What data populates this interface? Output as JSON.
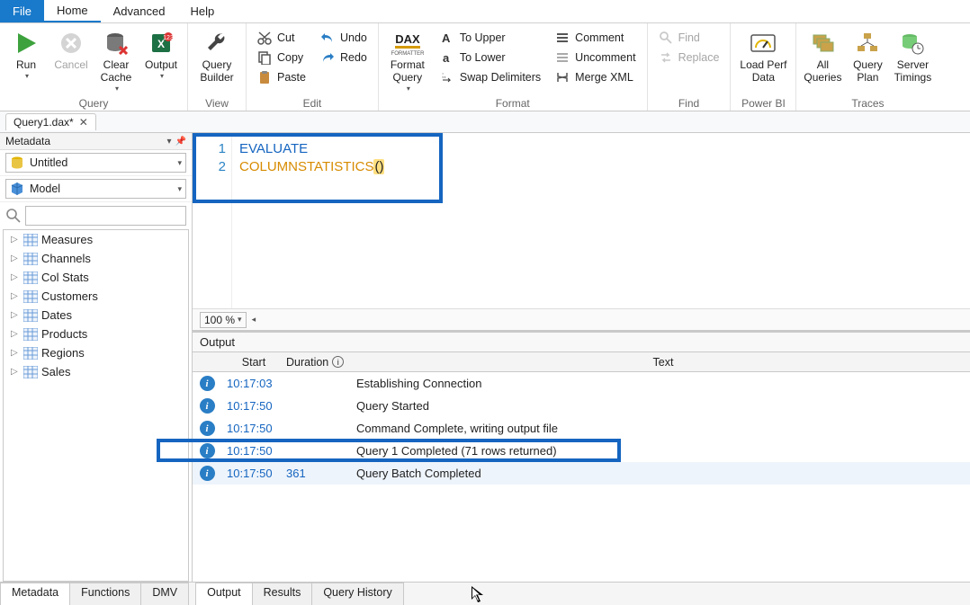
{
  "menu": {
    "file": "File",
    "home": "Home",
    "advanced": "Advanced",
    "help": "Help"
  },
  "ribbon": {
    "run": "Run",
    "cancel": "Cancel",
    "clear_cache": "Clear\nCache",
    "output": "Output",
    "query_builder": "Query\nBuilder",
    "cut": "Cut",
    "copy": "Copy",
    "paste": "Paste",
    "undo": "Undo",
    "redo": "Redo",
    "format_query": "Format\nQuery",
    "to_upper": "To Upper",
    "to_lower": "To Lower",
    "swap_delim": "Swap Delimiters",
    "comment": "Comment",
    "uncomment": "Uncomment",
    "merge_xml": "Merge XML",
    "find": "Find",
    "replace": "Replace",
    "load_perf": "Load Perf\nData",
    "all_queries": "All\nQueries",
    "query_plan": "Query\nPlan",
    "server_timings": "Server\nTimings",
    "groups": {
      "query": "Query",
      "view": "View",
      "edit": "Edit",
      "format": "Format",
      "find_g": "Find",
      "powerbi": "Power BI",
      "traces": "Traces"
    }
  },
  "doc_tab": {
    "name": "Query1.dax*"
  },
  "side": {
    "title": "Metadata",
    "db": "Untitled",
    "model": "Model",
    "items": [
      "Measures",
      "Channels",
      "Col Stats",
      "Customers",
      "Dates",
      "Products",
      "Regions",
      "Sales"
    ]
  },
  "editor": {
    "lines": [
      {
        "n": "1",
        "kw": "EVALUATE"
      },
      {
        "n": "2",
        "fn": "COLUMNSTATISTICS",
        "paren": "()"
      }
    ],
    "zoom": "100 %"
  },
  "output": {
    "title": "Output",
    "cols": {
      "start": "Start",
      "duration": "Duration",
      "text": "Text"
    },
    "rows": [
      {
        "start": "10:17:03",
        "dur": "",
        "text": "Establishing Connection"
      },
      {
        "start": "10:17:50",
        "dur": "",
        "text": "Query Started"
      },
      {
        "start": "10:17:50",
        "dur": "",
        "text": "Command Complete, writing output file"
      },
      {
        "start": "10:17:50",
        "dur": "",
        "text": "Query 1 Completed (71 rows returned)"
      },
      {
        "start": "10:17:50",
        "dur": "361",
        "text": "Query Batch Completed"
      }
    ]
  },
  "bottom": {
    "left": [
      "Metadata",
      "Functions",
      "DMV"
    ],
    "right": [
      "Output",
      "Results",
      "Query History"
    ]
  }
}
